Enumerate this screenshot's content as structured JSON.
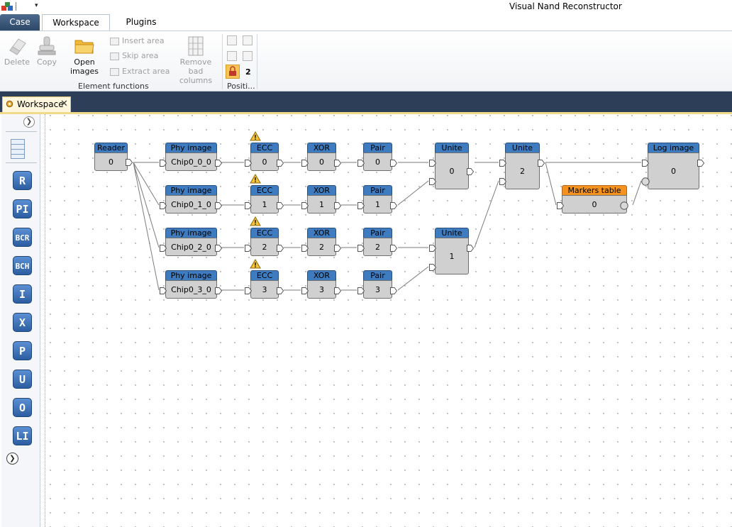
{
  "app": {
    "title": "Visual Nand Reconstructor"
  },
  "tabs": {
    "case": "Case",
    "workspace": "Workspace",
    "plugins": "Plugins"
  },
  "ribbon": {
    "delete": "Delete",
    "copy": "Copy",
    "open_images_1": "Open",
    "open_images_2": "images",
    "insert_area": "Insert area",
    "skip_area": "Skip area",
    "extract_area": "Extract area",
    "remove_bad_1": "Remove bad",
    "remove_bad_2": "columns",
    "group_element_functions": "Element functions",
    "position_value": "2",
    "group_position": "Positi..."
  },
  "document_tab": {
    "label": "Workspace"
  },
  "toolbox": {
    "tools": [
      {
        "label": "R"
      },
      {
        "label": "PI"
      },
      {
        "label": "BCR"
      },
      {
        "label": "BCH"
      },
      {
        "label": "I"
      },
      {
        "label": "X"
      },
      {
        "label": "P"
      },
      {
        "label": "U"
      },
      {
        "label": "O"
      },
      {
        "label": "LI"
      }
    ]
  },
  "nodes": {
    "reader": {
      "title": "Reader",
      "value": "0"
    },
    "phy0": {
      "title": "Phy image",
      "value": "Chip0_0_0"
    },
    "phy1": {
      "title": "Phy image",
      "value": "Chip0_1_0"
    },
    "phy2": {
      "title": "Phy image",
      "value": "Chip0_2_0"
    },
    "phy3": {
      "title": "Phy image",
      "value": "Chip0_3_0"
    },
    "ecc0": {
      "title": "ECC",
      "value": "0"
    },
    "ecc1": {
      "title": "ECC",
      "value": "1"
    },
    "ecc2": {
      "title": "ECC",
      "value": "2"
    },
    "ecc3": {
      "title": "ECC",
      "value": "3"
    },
    "xor0": {
      "title": "XOR",
      "value": "0"
    },
    "xor1": {
      "title": "XOR",
      "value": "1"
    },
    "xor2": {
      "title": "XOR",
      "value": "2"
    },
    "xor3": {
      "title": "XOR",
      "value": "3"
    },
    "pair0": {
      "title": "Pair",
      "value": "0"
    },
    "pair1": {
      "title": "Pair",
      "value": "1"
    },
    "pair2": {
      "title": "Pair",
      "value": "2"
    },
    "pair3": {
      "title": "Pair",
      "value": "3"
    },
    "unite0": {
      "title": "Unite",
      "value": "0"
    },
    "unite1": {
      "title": "Unite",
      "value": "1"
    },
    "unite2": {
      "title": "Unite",
      "value": "2"
    },
    "markers": {
      "title": "Markers table",
      "value": "0"
    },
    "logimage": {
      "title": "Log image",
      "value": "0"
    }
  },
  "colors": {
    "node_header": "#3f7bbf",
    "node_body": "#d0d0d0",
    "markers_header": "#f4921f",
    "band": "#2c3e58"
  }
}
